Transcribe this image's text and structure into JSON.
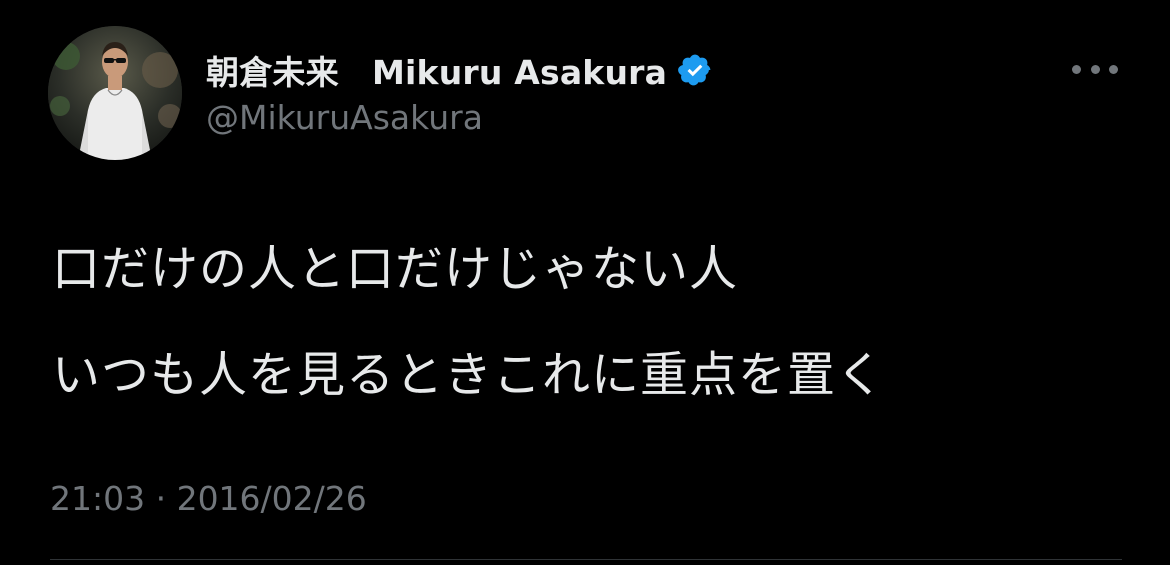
{
  "author": {
    "display_name": "朝倉未来　Mikuru Asakura",
    "handle": "@MikuruAsakura",
    "verified": true,
    "avatar_icon": "profile-photo"
  },
  "tweet": {
    "lines": [
      "口だけの人と口だけじゃない人",
      "いつも人を見るときこれに重点を置く"
    ],
    "timestamp": "21:03 · 2016/02/26"
  },
  "icons": {
    "verified": "verified-badge-icon",
    "more": "more-options-icon"
  },
  "colors": {
    "background": "#000000",
    "primary_text": "#e7e9ea",
    "secondary_text": "#71767b",
    "verified_blue": "#1d9bf0",
    "divider": "#2f3336"
  }
}
